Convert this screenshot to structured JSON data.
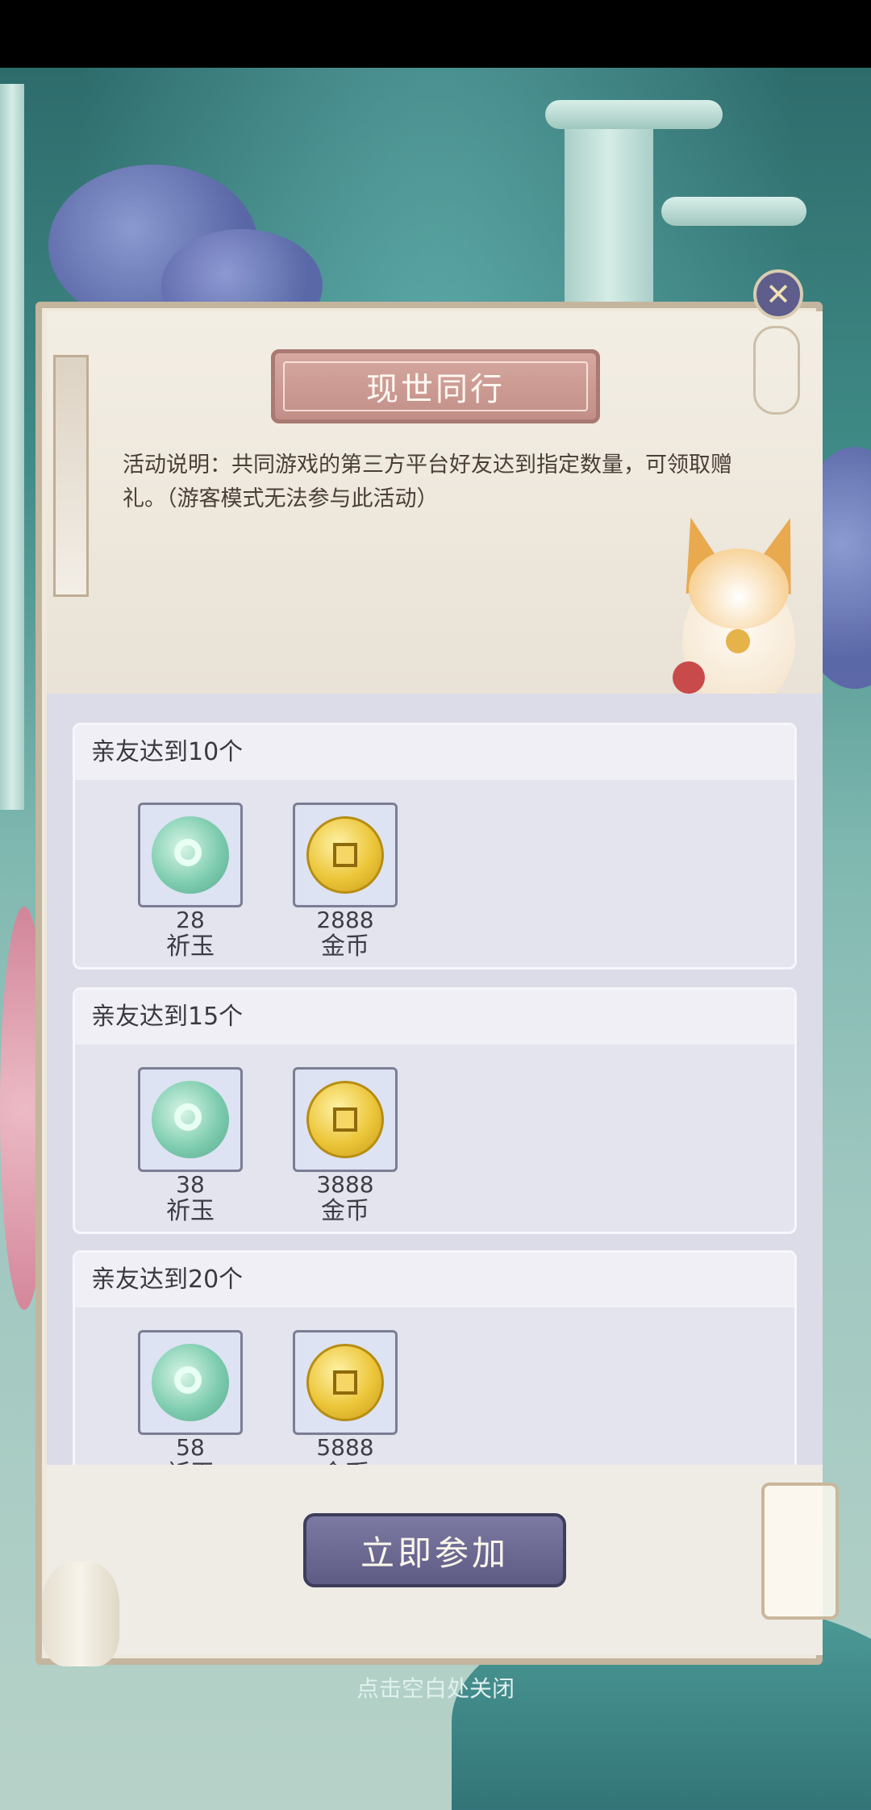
{
  "panel": {
    "title": "现世同行",
    "description": "活动说明：共同游戏的第三方平台好友达到指定数量，可领取赠礼。（游客模式无法参与此活动）"
  },
  "rewards": [
    {
      "condition": "亲友达到10个",
      "items": [
        {
          "icon": "jade-icon",
          "count": "28",
          "name": "祈玉"
        },
        {
          "icon": "gold-coin-icon",
          "count": "2888",
          "name": "金币"
        }
      ]
    },
    {
      "condition": "亲友达到15个",
      "items": [
        {
          "icon": "jade-icon",
          "count": "38",
          "name": "祈玉"
        },
        {
          "icon": "gold-coin-icon",
          "count": "3888",
          "name": "金币"
        }
      ]
    },
    {
      "condition": "亲友达到20个",
      "items": [
        {
          "icon": "jade-icon",
          "count": "58",
          "name": "祈玉"
        },
        {
          "icon": "gold-coin-icon",
          "count": "5888",
          "name": "金币"
        }
      ]
    }
  ],
  "actions": {
    "join_label": "立即参加",
    "close_hint": "点击空白处关闭"
  },
  "colors": {
    "button": "#6b6991",
    "title_plate": "#c99b94",
    "panel": "#efe8dc"
  }
}
